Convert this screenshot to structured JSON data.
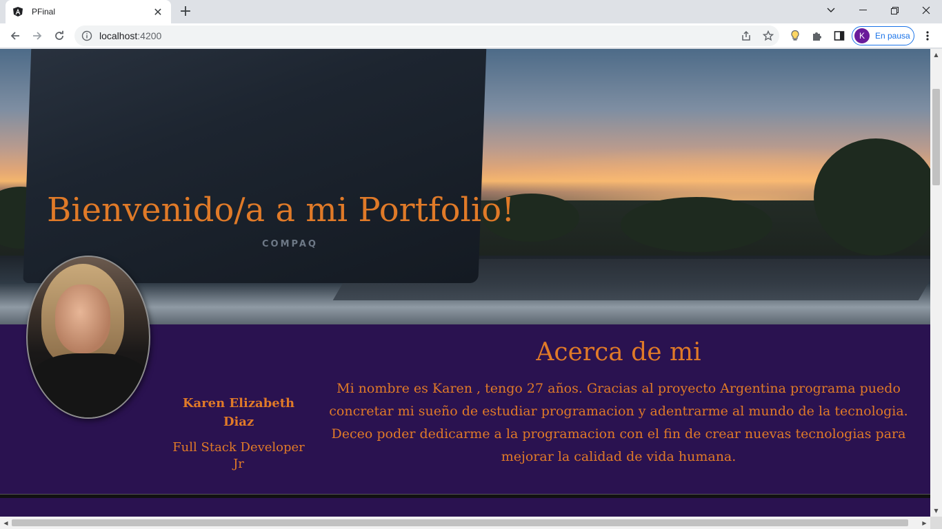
{
  "browser": {
    "tab_title": "PFinal",
    "new_tab_symbol": "+",
    "url_host": "localhost",
    "url_port": ":4200",
    "profile_initial": "K",
    "profile_status": "En pausa"
  },
  "hero": {
    "heading": "Bienvenido/a a mi Portfolio!",
    "laptop_brand": "COMPAQ"
  },
  "profile": {
    "name": "Karen Elizabeth Diaz",
    "role": "Full Stack Developer Jr"
  },
  "about": {
    "title": "Acerca de mi",
    "text": "Mi nombre es Karen , tengo 27 años. Gracias al proyecto Argentina programa puedo concretar mi sueño de estudiar programacion y adentrarme al mundo de la tecnologia. Deceo poder dedicarme a la programacion con el fin de crear nuevas tecnologias para mejorar la calidad de vida humana."
  },
  "colors": {
    "accent": "#e07a28",
    "band": "#2a1250"
  }
}
